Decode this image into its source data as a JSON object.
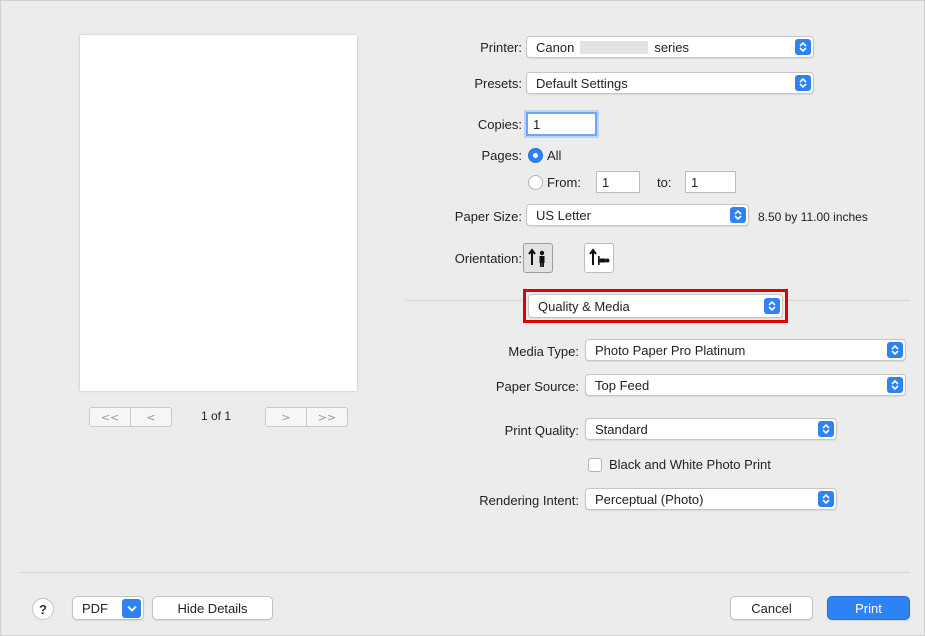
{
  "preview": {
    "page_label": "1 of 1",
    "first_icon": "double-chevron-left-icon",
    "prev_icon": "chevron-left-icon",
    "next_icon": "chevron-right-icon",
    "last_icon": "double-chevron-right-icon"
  },
  "settings": {
    "printer": {
      "label": "Printer:",
      "value_prefix": "Canon",
      "value_suffix": "series"
    },
    "presets": {
      "label": "Presets:",
      "value": "Default Settings"
    },
    "copies": {
      "label": "Copies:",
      "value": "1"
    },
    "pages": {
      "label": "Pages:",
      "all_label": "All",
      "from_label": "From:",
      "from_value": "1",
      "to_label": "to:",
      "to_value": "1",
      "selected": "All"
    },
    "paper_size": {
      "label": "Paper Size:",
      "value": "US Letter",
      "dimensions": "8.50 by 11.00 inches"
    },
    "orientation": {
      "label": "Orientation:",
      "options": [
        "portrait",
        "landscape"
      ],
      "selected": "portrait"
    },
    "section_popup": {
      "value": "Quality & Media"
    },
    "media_type": {
      "label": "Media Type:",
      "value": "Photo Paper Pro Platinum"
    },
    "paper_source": {
      "label": "Paper Source:",
      "value": "Top Feed"
    },
    "print_quality": {
      "label": "Print Quality:",
      "value": "Standard"
    },
    "bw_photo": {
      "label": "Black and White Photo Print",
      "checked": false
    },
    "rendering_intent": {
      "label": "Rendering Intent:",
      "value": "Perceptual (Photo)"
    }
  },
  "footer": {
    "help_label": "?",
    "pdf_label": "PDF",
    "hide_details_label": "Hide Details",
    "cancel_label": "Cancel",
    "print_label": "Print"
  },
  "colors": {
    "accent": "#2d82f5",
    "highlight": "#e00000"
  }
}
